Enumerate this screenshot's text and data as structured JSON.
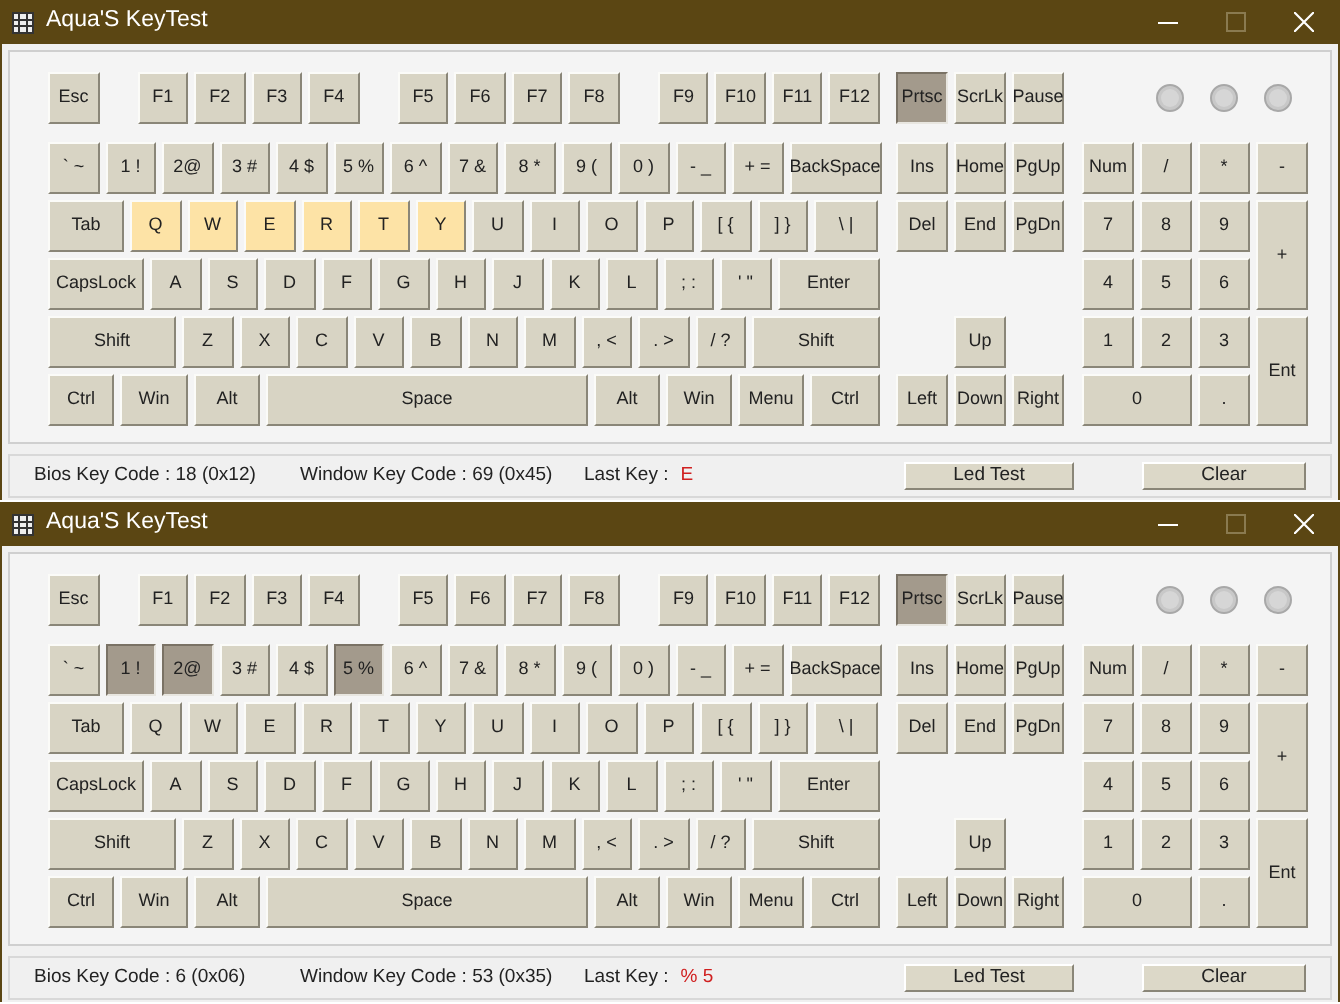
{
  "windows": [
    {
      "title": "Aqua'S KeyTest",
      "function_groups": [
        [
          {
            "label": "Esc",
            "highlighted": false,
            "pressed": false
          }
        ],
        [
          {
            "label": "F1",
            "highlighted": false,
            "pressed": false
          },
          {
            "label": "F2",
            "highlighted": false,
            "pressed": false
          },
          {
            "label": "F3",
            "highlighted": false,
            "pressed": false
          },
          {
            "label": "F4",
            "highlighted": false,
            "pressed": false
          }
        ],
        [
          {
            "label": "F5",
            "highlighted": false,
            "pressed": false
          },
          {
            "label": "F6",
            "highlighted": false,
            "pressed": false
          },
          {
            "label": "F7",
            "highlighted": false,
            "pressed": false
          },
          {
            "label": "F8",
            "highlighted": false,
            "pressed": false
          }
        ],
        [
          {
            "label": "F9",
            "highlighted": false,
            "pressed": false
          },
          {
            "label": "F10",
            "highlighted": false,
            "pressed": false
          },
          {
            "label": "F11",
            "highlighted": false,
            "pressed": false
          },
          {
            "label": "F12",
            "highlighted": false,
            "pressed": false
          }
        ]
      ],
      "main_rows": [
        [
          {
            "label": "` ~",
            "highlighted": false,
            "pressed": false
          },
          {
            "label": "1 !",
            "highlighted": false,
            "pressed": false
          },
          {
            "label": "2@",
            "highlighted": false,
            "pressed": false
          },
          {
            "label": "3 #",
            "highlighted": false,
            "pressed": false
          },
          {
            "label": "4 $",
            "highlighted": false,
            "pressed": false
          },
          {
            "label": "5 %",
            "highlighted": false,
            "pressed": false
          },
          {
            "label": "6 ^",
            "highlighted": false,
            "pressed": false
          },
          {
            "label": "7 &",
            "highlighted": false,
            "pressed": false
          },
          {
            "label": "8 *",
            "highlighted": false,
            "pressed": false
          },
          {
            "label": "9 (",
            "highlighted": false,
            "pressed": false
          },
          {
            "label": "0 )",
            "highlighted": false,
            "pressed": false
          },
          {
            "label": "- _",
            "highlighted": false,
            "pressed": false
          },
          {
            "label": "+ =",
            "highlighted": false,
            "pressed": false
          },
          {
            "label": "BackSpace",
            "highlighted": false,
            "pressed": false
          }
        ],
        [
          {
            "label": "Tab",
            "highlighted": false,
            "pressed": false
          },
          {
            "label": "Q",
            "highlighted": true,
            "pressed": false
          },
          {
            "label": "W",
            "highlighted": true,
            "pressed": false
          },
          {
            "label": "E",
            "highlighted": true,
            "pressed": false
          },
          {
            "label": "R",
            "highlighted": true,
            "pressed": false
          },
          {
            "label": "T",
            "highlighted": true,
            "pressed": false
          },
          {
            "label": "Y",
            "highlighted": true,
            "pressed": false
          },
          {
            "label": "U",
            "highlighted": false,
            "pressed": false
          },
          {
            "label": "I",
            "highlighted": false,
            "pressed": false
          },
          {
            "label": "O",
            "highlighted": false,
            "pressed": false
          },
          {
            "label": "P",
            "highlighted": false,
            "pressed": false
          },
          {
            "label": "[ {",
            "highlighted": false,
            "pressed": false
          },
          {
            "label": "] }",
            "highlighted": false,
            "pressed": false
          },
          {
            "label": "\\ |",
            "highlighted": false,
            "pressed": false
          }
        ],
        [
          {
            "label": "CapsLock",
            "highlighted": false,
            "pressed": false
          },
          {
            "label": "A",
            "highlighted": false,
            "pressed": false
          },
          {
            "label": "S",
            "highlighted": false,
            "pressed": false
          },
          {
            "label": "D",
            "highlighted": false,
            "pressed": false
          },
          {
            "label": "F",
            "highlighted": false,
            "pressed": false
          },
          {
            "label": "G",
            "highlighted": false,
            "pressed": false
          },
          {
            "label": "H",
            "highlighted": false,
            "pressed": false
          },
          {
            "label": "J",
            "highlighted": false,
            "pressed": false
          },
          {
            "label": "K",
            "highlighted": false,
            "pressed": false
          },
          {
            "label": "L",
            "highlighted": false,
            "pressed": false
          },
          {
            "label": "; :",
            "highlighted": false,
            "pressed": false
          },
          {
            "label": "' \"",
            "highlighted": false,
            "pressed": false
          },
          {
            "label": "Enter",
            "highlighted": false,
            "pressed": false
          }
        ],
        [
          {
            "label": "Shift",
            "highlighted": false,
            "pressed": false
          },
          {
            "label": "Z",
            "highlighted": false,
            "pressed": false
          },
          {
            "label": "X",
            "highlighted": false,
            "pressed": false
          },
          {
            "label": "C",
            "highlighted": false,
            "pressed": false
          },
          {
            "label": "V",
            "highlighted": false,
            "pressed": false
          },
          {
            "label": "B",
            "highlighted": false,
            "pressed": false
          },
          {
            "label": "N",
            "highlighted": false,
            "pressed": false
          },
          {
            "label": "M",
            "highlighted": false,
            "pressed": false
          },
          {
            "label": ", <",
            "highlighted": false,
            "pressed": false
          },
          {
            "label": ". >",
            "highlighted": false,
            "pressed": false
          },
          {
            "label": "/ ?",
            "highlighted": false,
            "pressed": false
          },
          {
            "label": "Shift",
            "highlighted": false,
            "pressed": false
          }
        ],
        [
          {
            "label": "Ctrl",
            "highlighted": false,
            "pressed": false
          },
          {
            "label": "Win",
            "highlighted": false,
            "pressed": false
          },
          {
            "label": "Alt",
            "highlighted": false,
            "pressed": false
          },
          {
            "label": "Space",
            "highlighted": false,
            "pressed": false
          },
          {
            "label": "Alt",
            "highlighted": false,
            "pressed": false
          },
          {
            "label": "Win",
            "highlighted": false,
            "pressed": false
          },
          {
            "label": "Menu",
            "highlighted": false,
            "pressed": false
          },
          {
            "label": "Ctrl",
            "highlighted": false,
            "pressed": false
          }
        ]
      ],
      "system_keys": [
        {
          "label": "Prtsc",
          "highlighted": false,
          "pressed": true
        },
        {
          "label": "ScrLk",
          "highlighted": false,
          "pressed": false
        },
        {
          "label": "Pause",
          "highlighted": false,
          "pressed": false
        }
      ],
      "nav_keys": [
        {
          "label": "Ins",
          "highlighted": false,
          "pressed": false
        },
        {
          "label": "Home",
          "highlighted": false,
          "pressed": false
        },
        {
          "label": "PgUp",
          "highlighted": false,
          "pressed": false
        },
        {
          "label": "Del",
          "highlighted": false,
          "pressed": false
        },
        {
          "label": "End",
          "highlighted": false,
          "pressed": false
        },
        {
          "label": "PgDn",
          "highlighted": false,
          "pressed": false
        }
      ],
      "arrow_keys": [
        {
          "label": "Up",
          "highlighted": false,
          "pressed": false
        },
        {
          "label": "Left",
          "highlighted": false,
          "pressed": false
        },
        {
          "label": "Down",
          "highlighted": false,
          "pressed": false
        },
        {
          "label": "Right",
          "highlighted": false,
          "pressed": false
        }
      ],
      "numpad": [
        {
          "label": "Num",
          "highlighted": false,
          "pressed": false
        },
        {
          "label": "/",
          "highlighted": false,
          "pressed": false
        },
        {
          "label": "*",
          "highlighted": false,
          "pressed": false
        },
        {
          "label": "-",
          "highlighted": false,
          "pressed": false
        },
        {
          "label": "7",
          "highlighted": false,
          "pressed": false
        },
        {
          "label": "8",
          "highlighted": false,
          "pressed": false
        },
        {
          "label": "9",
          "highlighted": false,
          "pressed": false
        },
        {
          "label": "+",
          "highlighted": false,
          "pressed": false
        },
        {
          "label": "4",
          "highlighted": false,
          "pressed": false
        },
        {
          "label": "5",
          "highlighted": false,
          "pressed": false
        },
        {
          "label": "6",
          "highlighted": false,
          "pressed": false
        },
        {
          "label": "1",
          "highlighted": false,
          "pressed": false
        },
        {
          "label": "2",
          "highlighted": false,
          "pressed": false
        },
        {
          "label": "3",
          "highlighted": false,
          "pressed": false
        },
        {
          "label": "Ent",
          "highlighted": false,
          "pressed": false
        },
        {
          "label": "0",
          "highlighted": false,
          "pressed": false
        },
        {
          "label": ".",
          "highlighted": false,
          "pressed": false
        }
      ],
      "status": {
        "bios_key_code": "Bios Key Code : 18 (0x12)",
        "window_key_code": "Window Key Code : 69 (0x45)",
        "last_key_label": "Last Key :",
        "last_key": "E"
      },
      "buttons": [
        "Led Test",
        "Clear"
      ]
    },
    {
      "title": "Aqua'S KeyTest",
      "function_groups": [
        [
          {
            "label": "Esc",
            "highlighted": false,
            "pressed": false
          }
        ],
        [
          {
            "label": "F1",
            "highlighted": false,
            "pressed": false
          },
          {
            "label": "F2",
            "highlighted": false,
            "pressed": false
          },
          {
            "label": "F3",
            "highlighted": false,
            "pressed": false
          },
          {
            "label": "F4",
            "highlighted": false,
            "pressed": false
          }
        ],
        [
          {
            "label": "F5",
            "highlighted": false,
            "pressed": false
          },
          {
            "label": "F6",
            "highlighted": false,
            "pressed": false
          },
          {
            "label": "F7",
            "highlighted": false,
            "pressed": false
          },
          {
            "label": "F8",
            "highlighted": false,
            "pressed": false
          }
        ],
        [
          {
            "label": "F9",
            "highlighted": false,
            "pressed": false
          },
          {
            "label": "F10",
            "highlighted": false,
            "pressed": false
          },
          {
            "label": "F11",
            "highlighted": false,
            "pressed": false
          },
          {
            "label": "F12",
            "highlighted": false,
            "pressed": false
          }
        ]
      ],
      "main_rows": [
        [
          {
            "label": "` ~",
            "highlighted": false,
            "pressed": false
          },
          {
            "label": "1 !",
            "highlighted": false,
            "pressed": true
          },
          {
            "label": "2@",
            "highlighted": false,
            "pressed": true
          },
          {
            "label": "3 #",
            "highlighted": false,
            "pressed": false
          },
          {
            "label": "4 $",
            "highlighted": false,
            "pressed": false
          },
          {
            "label": "5 %",
            "highlighted": false,
            "pressed": true
          },
          {
            "label": "6 ^",
            "highlighted": false,
            "pressed": false
          },
          {
            "label": "7 &",
            "highlighted": false,
            "pressed": false
          },
          {
            "label": "8 *",
            "highlighted": false,
            "pressed": false
          },
          {
            "label": "9 (",
            "highlighted": false,
            "pressed": false
          },
          {
            "label": "0 )",
            "highlighted": false,
            "pressed": false
          },
          {
            "label": "- _",
            "highlighted": false,
            "pressed": false
          },
          {
            "label": "+ =",
            "highlighted": false,
            "pressed": false
          },
          {
            "label": "BackSpace",
            "highlighted": false,
            "pressed": false
          }
        ],
        [
          {
            "label": "Tab",
            "highlighted": false,
            "pressed": false
          },
          {
            "label": "Q",
            "highlighted": false,
            "pressed": false
          },
          {
            "label": "W",
            "highlighted": false,
            "pressed": false
          },
          {
            "label": "E",
            "highlighted": false,
            "pressed": false
          },
          {
            "label": "R",
            "highlighted": false,
            "pressed": false
          },
          {
            "label": "T",
            "highlighted": false,
            "pressed": false
          },
          {
            "label": "Y",
            "highlighted": false,
            "pressed": false
          },
          {
            "label": "U",
            "highlighted": false,
            "pressed": false
          },
          {
            "label": "I",
            "highlighted": false,
            "pressed": false
          },
          {
            "label": "O",
            "highlighted": false,
            "pressed": false
          },
          {
            "label": "P",
            "highlighted": false,
            "pressed": false
          },
          {
            "label": "[ {",
            "highlighted": false,
            "pressed": false
          },
          {
            "label": "] }",
            "highlighted": false,
            "pressed": false
          },
          {
            "label": "\\ |",
            "highlighted": false,
            "pressed": false
          }
        ],
        [
          {
            "label": "CapsLock",
            "highlighted": false,
            "pressed": false
          },
          {
            "label": "A",
            "highlighted": false,
            "pressed": false
          },
          {
            "label": "S",
            "highlighted": false,
            "pressed": false
          },
          {
            "label": "D",
            "highlighted": false,
            "pressed": false
          },
          {
            "label": "F",
            "highlighted": false,
            "pressed": false
          },
          {
            "label": "G",
            "highlighted": false,
            "pressed": false
          },
          {
            "label": "H",
            "highlighted": false,
            "pressed": false
          },
          {
            "label": "J",
            "highlighted": false,
            "pressed": false
          },
          {
            "label": "K",
            "highlighted": false,
            "pressed": false
          },
          {
            "label": "L",
            "highlighted": false,
            "pressed": false
          },
          {
            "label": "; :",
            "highlighted": false,
            "pressed": false
          },
          {
            "label": "' \"",
            "highlighted": false,
            "pressed": false
          },
          {
            "label": "Enter",
            "highlighted": false,
            "pressed": false
          }
        ],
        [
          {
            "label": "Shift",
            "highlighted": false,
            "pressed": false
          },
          {
            "label": "Z",
            "highlighted": false,
            "pressed": false
          },
          {
            "label": "X",
            "highlighted": false,
            "pressed": false
          },
          {
            "label": "C",
            "highlighted": false,
            "pressed": false
          },
          {
            "label": "V",
            "highlighted": false,
            "pressed": false
          },
          {
            "label": "B",
            "highlighted": false,
            "pressed": false
          },
          {
            "label": "N",
            "highlighted": false,
            "pressed": false
          },
          {
            "label": "M",
            "highlighted": false,
            "pressed": false
          },
          {
            "label": ", <",
            "highlighted": false,
            "pressed": false
          },
          {
            "label": ". >",
            "highlighted": false,
            "pressed": false
          },
          {
            "label": "/ ?",
            "highlighted": false,
            "pressed": false
          },
          {
            "label": "Shift",
            "highlighted": false,
            "pressed": false
          }
        ],
        [
          {
            "label": "Ctrl",
            "highlighted": false,
            "pressed": false
          },
          {
            "label": "Win",
            "highlighted": false,
            "pressed": false
          },
          {
            "label": "Alt",
            "highlighted": false,
            "pressed": false
          },
          {
            "label": "Space",
            "highlighted": false,
            "pressed": false
          },
          {
            "label": "Alt",
            "highlighted": false,
            "pressed": false
          },
          {
            "label": "Win",
            "highlighted": false,
            "pressed": false
          },
          {
            "label": "Menu",
            "highlighted": false,
            "pressed": false
          },
          {
            "label": "Ctrl",
            "highlighted": false,
            "pressed": false
          }
        ]
      ],
      "system_keys": [
        {
          "label": "Prtsc",
          "highlighted": false,
          "pressed": true
        },
        {
          "label": "ScrLk",
          "highlighted": false,
          "pressed": false
        },
        {
          "label": "Pause",
          "highlighted": false,
          "pressed": false
        }
      ],
      "nav_keys": [
        {
          "label": "Ins",
          "highlighted": false,
          "pressed": false
        },
        {
          "label": "Home",
          "highlighted": false,
          "pressed": false
        },
        {
          "label": "PgUp",
          "highlighted": false,
          "pressed": false
        },
        {
          "label": "Del",
          "highlighted": false,
          "pressed": false
        },
        {
          "label": "End",
          "highlighted": false,
          "pressed": false
        },
        {
          "label": "PgDn",
          "highlighted": false,
          "pressed": false
        }
      ],
      "arrow_keys": [
        {
          "label": "Up",
          "highlighted": false,
          "pressed": false
        },
        {
          "label": "Left",
          "highlighted": false,
          "pressed": false
        },
        {
          "label": "Down",
          "highlighted": false,
          "pressed": false
        },
        {
          "label": "Right",
          "highlighted": false,
          "pressed": false
        }
      ],
      "numpad": [
        {
          "label": "Num",
          "highlighted": false,
          "pressed": false
        },
        {
          "label": "/",
          "highlighted": false,
          "pressed": false
        },
        {
          "label": "*",
          "highlighted": false,
          "pressed": false
        },
        {
          "label": "-",
          "highlighted": false,
          "pressed": false
        },
        {
          "label": "7",
          "highlighted": false,
          "pressed": false
        },
        {
          "label": "8",
          "highlighted": false,
          "pressed": false
        },
        {
          "label": "9",
          "highlighted": false,
          "pressed": false
        },
        {
          "label": "+",
          "highlighted": false,
          "pressed": false
        },
        {
          "label": "4",
          "highlighted": false,
          "pressed": false
        },
        {
          "label": "5",
          "highlighted": false,
          "pressed": false
        },
        {
          "label": "6",
          "highlighted": false,
          "pressed": false
        },
        {
          "label": "1",
          "highlighted": false,
          "pressed": false
        },
        {
          "label": "2",
          "highlighted": false,
          "pressed": false
        },
        {
          "label": "3",
          "highlighted": false,
          "pressed": false
        },
        {
          "label": "Ent",
          "highlighted": false,
          "pressed": false
        },
        {
          "label": "0",
          "highlighted": false,
          "pressed": false
        },
        {
          "label": ".",
          "highlighted": false,
          "pressed": false
        }
      ],
      "status": {
        "bios_key_code": "Bios Key Code : 6 (0x06)",
        "window_key_code": "Window Key Code : 53 (0x35)",
        "last_key_label": "Last Key :",
        "last_key": "% 5"
      },
      "buttons": [
        "Led Test",
        "Clear"
      ]
    }
  ]
}
